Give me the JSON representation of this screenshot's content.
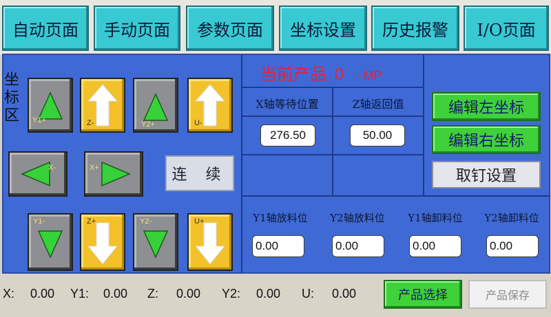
{
  "tabs": [
    {
      "label": "自动页面"
    },
    {
      "label": "手动页面"
    },
    {
      "label": "参数页面"
    },
    {
      "label": "坐标设置"
    },
    {
      "label": "历史报警"
    },
    {
      "label": "I/O页面"
    }
  ],
  "jog": {
    "section_title": "坐标区",
    "buttons": [
      {
        "label": "Y1+",
        "icon": "triangle-up-icon"
      },
      {
        "label": "Z-",
        "icon": "arrow-up-icon"
      },
      {
        "label": "Y2+",
        "icon": "triangle-up-icon"
      },
      {
        "label": "U-",
        "icon": "arrow-up-icon"
      },
      {
        "label": "X-",
        "icon": "triangle-left-icon"
      },
      {
        "label": "X+",
        "icon": "triangle-right-icon"
      },
      {
        "label": "Y1-",
        "icon": "triangle-down-icon"
      },
      {
        "label": "Z+",
        "icon": "arrow-down-icon"
      },
      {
        "label": "Y2-",
        "icon": "triangle-down-icon"
      },
      {
        "label": "U+",
        "icon": "arrow-down-icon"
      }
    ],
    "continuous_label": "连 续"
  },
  "product": {
    "prefix": "当前产品",
    "number": "0",
    "suffix": "- MP"
  },
  "axis_wait": {
    "x_header": "X轴等待位置",
    "z_header": "Z轴返回值",
    "x_value": "276.50",
    "z_value": "50.00"
  },
  "actions": {
    "edit_left": "编辑左坐标",
    "edit_right": "编辑右坐标",
    "pick_setting": "取钉设置"
  },
  "positions": {
    "headers": [
      "Y1轴放料位",
      "Y2轴放料位",
      "Y1轴卸料位",
      "Y2轴卸料位"
    ],
    "values": [
      "0.00",
      "0.00",
      "0.00",
      "0.00"
    ]
  },
  "status": {
    "x_label": "X:",
    "x_value": "0.00",
    "y1_label": "Y1:",
    "y1_value": "0.00",
    "z_label": "Z:",
    "z_value": "0.00",
    "y2_label": "Y2:",
    "y2_value": "0.00",
    "u_label": "U:",
    "u_value": "0.00"
  },
  "bottom_buttons": {
    "select": "产品选择",
    "save": "产品保存"
  },
  "colors": {
    "tab": "#39c9d2",
    "panel": "#3f6ad6",
    "jog_gray": "#8d8f93",
    "jog_yellow": "#f3c12a",
    "green_button": "#3fd13a",
    "product_red": "#e8203a"
  }
}
